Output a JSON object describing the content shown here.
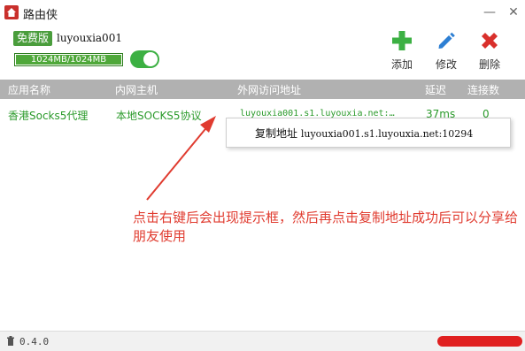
{
  "window": {
    "title": "路由侠",
    "minimize": "—",
    "close": "✕"
  },
  "account": {
    "badge": "免费版",
    "username": "luyouxia001",
    "quota_text": "1024MB/1024MB",
    "quota_fraction": 1.0,
    "toggle_on": true
  },
  "toolbar": {
    "add_label": "添加",
    "edit_label": "修改",
    "delete_label": "删除"
  },
  "table": {
    "columns": [
      "应用名称",
      "内网主机",
      "外网访问地址",
      "延迟",
      "连接数"
    ],
    "rows": [
      {
        "app": "香港Socks5代理",
        "host": "本地SOCKS5协议",
        "address": "luyouxia001.s1.luyouxia.net:…",
        "latency": "37ms",
        "connections": "0"
      }
    ]
  },
  "context_menu": {
    "copy_label": "复制地址",
    "copy_value": "luyouxia001.s1.luyouxia.net:10294"
  },
  "annotation": {
    "text": "点击右键后会出现提示框，然后再点击复制地址成功后可以分享给朋友使用"
  },
  "status": {
    "version": "0.4.0"
  },
  "colors": {
    "accent_green": "#4fa83a",
    "header_gray": "#b1b1b1",
    "add_green": "#3cb043",
    "edit_blue": "#2d7fd3",
    "delete_red": "#d9302c",
    "annotation_red": "#e03b2f"
  }
}
